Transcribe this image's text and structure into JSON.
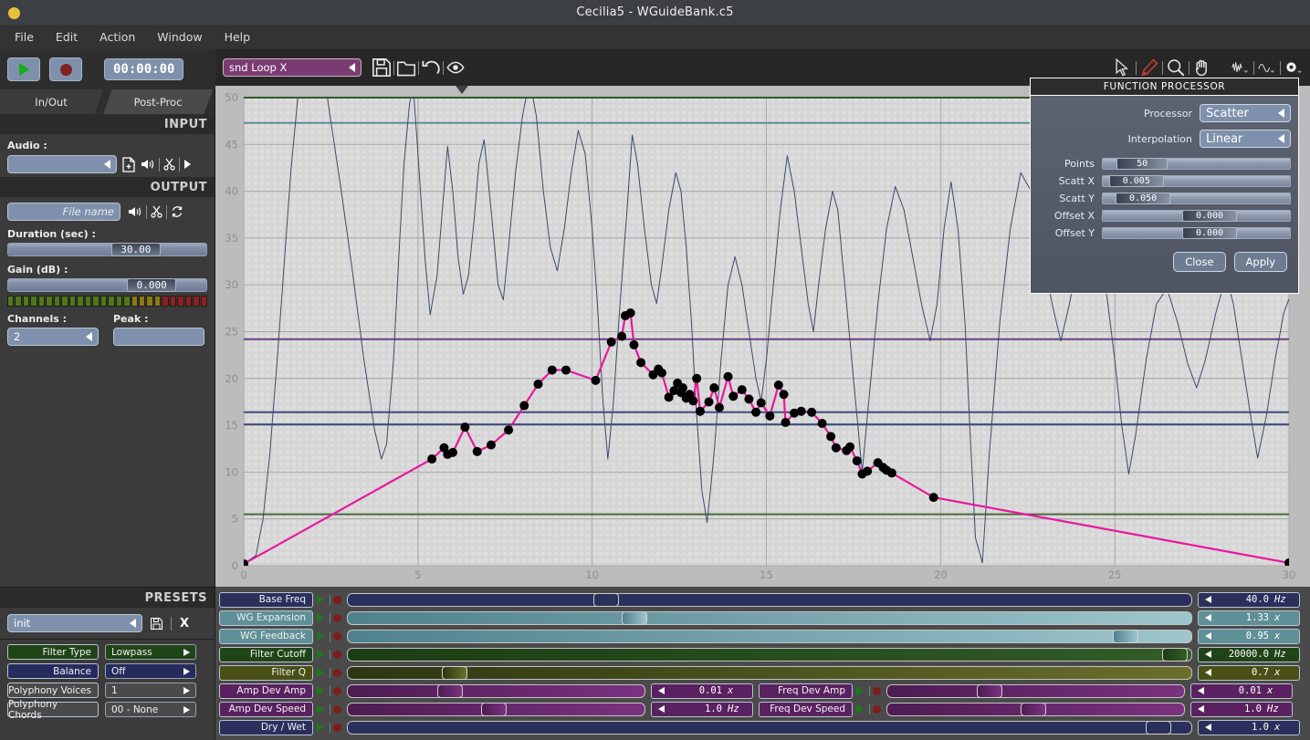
{
  "window": {
    "title": "Cecilia5 - WGuideBank.c5",
    "close_icon": "close-dot"
  },
  "menu": {
    "items": [
      "File",
      "Edit",
      "Action",
      "Window",
      "Help"
    ]
  },
  "transport": {
    "play_icon": "play-icon",
    "record_icon": "record-icon",
    "clock": "00:00:00"
  },
  "tabs": [
    {
      "label": "In/Out",
      "active": true
    },
    {
      "label": "Post-Proc",
      "active": false
    }
  ],
  "input": {
    "header": "INPUT",
    "audio_label": "Audio :",
    "audio_value": "",
    "icons": [
      "file-add-icon",
      "speaker-icon",
      "scissors-icon",
      "play-small-icon"
    ]
  },
  "output": {
    "header": "OUTPUT",
    "filename_placeholder": "File name",
    "icons": [
      "speaker-icon",
      "scissors-icon",
      "recycle-icon"
    ],
    "duration_label": "Duration (sec) :",
    "duration_value": "30.00",
    "gain_label": "Gain (dB) :",
    "gain_value": "0.000",
    "channels_label": "Channels :",
    "channels_value": "2",
    "peak_label": "Peak :",
    "peak_value": ""
  },
  "presets": {
    "header": "PRESETS",
    "selected": "init",
    "save_icon": "save-icon",
    "delete_label": "X",
    "rows": [
      {
        "name": "Filter Type",
        "value": "Lowpass",
        "color": "#1f4417",
        "has_popup": true
      },
      {
        "name": "Balance",
        "value": "Off",
        "color": "#262b5e",
        "has_popup": true
      },
      {
        "name": "Polyphony Voices",
        "value": "1",
        "color": "#585858",
        "has_popup": true
      },
      {
        "name": "Polyphony Chords",
        "value": "00 - None",
        "color": "#585858",
        "has_popup": true
      }
    ]
  },
  "toolbar": {
    "snd_popup": "snd Loop X",
    "left_icons": [
      "save-icon",
      "folder-icon",
      "undo-icon",
      "eye-icon"
    ],
    "right_icons": [
      "pointer-icon",
      "pencil-icon",
      "zoom-icon",
      "hand-icon",
      "waveform-icon",
      "envelope-icon",
      "gear-icon"
    ]
  },
  "graph": {
    "marker_icon": "playhead-marker-icon"
  },
  "chart_data": {
    "type": "line",
    "title": "",
    "xlabel": "",
    "ylabel": "",
    "xlim": [
      0,
      30
    ],
    "ylim": [
      0,
      50
    ],
    "xticks": [
      0,
      5,
      10,
      15,
      20,
      25,
      30
    ],
    "yticks": [
      0,
      5,
      10,
      15,
      20,
      25,
      30,
      35,
      40,
      45,
      50
    ],
    "grid": true,
    "legend": null,
    "hlines": [
      {
        "y": 50.0,
        "color": "#2f5a2f"
      },
      {
        "y": 47.3,
        "color": "#5f8f9b"
      },
      {
        "y": 24.2,
        "color": "#6a3f80"
      },
      {
        "y": 16.4,
        "color": "#3c4c7c"
      },
      {
        "y": 15.1,
        "color": "#3c4c7c"
      },
      {
        "y": 5.5,
        "color": "#4a6b3b"
      }
    ],
    "series": [
      {
        "name": "oscillation",
        "color": "#3b4a6b",
        "width": 1,
        "markers": false,
        "points": [
          [
            0.0,
            0.2
          ],
          [
            0.35,
            1.1
          ],
          [
            0.55,
            4.9
          ],
          [
            0.75,
            12.0
          ],
          [
            1.0,
            24.0
          ],
          [
            1.35,
            42.0
          ],
          [
            1.55,
            50.0
          ],
          [
            2.0,
            58.0
          ],
          [
            2.4,
            50.0
          ],
          [
            2.8,
            40.0
          ],
          [
            3.1,
            32.0
          ],
          [
            3.45,
            22.0
          ],
          [
            3.75,
            14.6
          ],
          [
            3.95,
            11.4
          ],
          [
            4.1,
            13.0
          ],
          [
            4.3,
            22.0
          ],
          [
            4.45,
            33.0
          ],
          [
            4.6,
            43.0
          ],
          [
            4.75,
            49.0
          ],
          [
            4.85,
            52.0
          ],
          [
            5.0,
            44.0
          ],
          [
            5.2,
            33.0
          ],
          [
            5.35,
            26.8
          ],
          [
            5.55,
            31.0
          ],
          [
            5.7,
            38.0
          ],
          [
            5.85,
            44.8
          ],
          [
            6.0,
            40.0
          ],
          [
            6.15,
            33.0
          ],
          [
            6.3,
            29.0
          ],
          [
            6.45,
            31.0
          ],
          [
            6.6,
            36.5
          ],
          [
            6.75,
            43.0
          ],
          [
            6.9,
            45.5
          ],
          [
            7.1,
            38.0
          ],
          [
            7.3,
            30.0
          ],
          [
            7.45,
            28.4
          ],
          [
            7.6,
            34.0
          ],
          [
            7.8,
            42.0
          ],
          [
            8.0,
            48.0
          ],
          [
            8.2,
            52.0
          ],
          [
            8.4,
            48.0
          ],
          [
            8.6,
            40.0
          ],
          [
            8.8,
            34.0
          ],
          [
            9.0,
            31.5
          ],
          [
            9.2,
            36.0
          ],
          [
            9.4,
            42.0
          ],
          [
            9.6,
            46.5
          ],
          [
            9.8,
            44.0
          ],
          [
            10.0,
            36.0
          ],
          [
            10.15,
            28.0
          ],
          [
            10.3,
            18.0
          ],
          [
            10.45,
            11.4
          ],
          [
            10.6,
            17.0
          ],
          [
            10.8,
            28.0
          ],
          [
            11.0,
            38.0
          ],
          [
            11.15,
            46.0
          ],
          [
            11.3,
            43.0
          ],
          [
            11.5,
            36.0
          ],
          [
            11.7,
            30.0
          ],
          [
            11.85,
            28.0
          ],
          [
            12.0,
            32.0
          ],
          [
            12.2,
            38.0
          ],
          [
            12.4,
            42.0
          ],
          [
            12.55,
            40.0
          ],
          [
            12.7,
            34.0
          ],
          [
            12.85,
            26.0
          ],
          [
            13.0,
            16.0
          ],
          [
            13.15,
            8.0
          ],
          [
            13.3,
            4.6
          ],
          [
            13.5,
            12.0
          ],
          [
            13.7,
            22.0
          ],
          [
            13.9,
            30.0
          ],
          [
            14.1,
            33.0
          ],
          [
            14.3,
            30.0
          ],
          [
            14.5,
            25.0
          ],
          [
            14.7,
            20.0
          ],
          [
            14.85,
            17.6
          ],
          [
            15.0,
            22.0
          ],
          [
            15.2,
            30.0
          ],
          [
            15.4,
            38.0
          ],
          [
            15.6,
            43.8
          ],
          [
            15.8,
            40.0
          ],
          [
            16.0,
            34.0
          ],
          [
            16.2,
            28.0
          ],
          [
            16.35,
            25.0
          ],
          [
            16.5,
            30.0
          ],
          [
            16.7,
            36.0
          ],
          [
            16.9,
            40.0
          ],
          [
            17.05,
            38.0
          ],
          [
            17.2,
            32.0
          ],
          [
            17.4,
            24.0
          ],
          [
            17.6,
            16.0
          ],
          [
            17.75,
            10.0
          ],
          [
            17.95,
            18.0
          ],
          [
            18.2,
            28.0
          ],
          [
            18.45,
            36.0
          ],
          [
            18.7,
            40.5
          ],
          [
            18.95,
            38.0
          ],
          [
            19.2,
            33.0
          ],
          [
            19.45,
            28.0
          ],
          [
            19.7,
            24.0
          ],
          [
            19.9,
            28.0
          ],
          [
            20.1,
            36.0
          ],
          [
            20.3,
            41.0
          ],
          [
            20.5,
            36.0
          ],
          [
            20.7,
            26.0
          ],
          [
            20.85,
            14.0
          ],
          [
            21.0,
            3.0
          ],
          [
            21.2,
            0.3
          ],
          [
            21.4,
            12.0
          ],
          [
            21.7,
            26.0
          ],
          [
            22.0,
            36.0
          ],
          [
            22.3,
            42.0
          ],
          [
            22.6,
            40.0
          ],
          [
            22.9,
            34.0
          ],
          [
            23.2,
            28.0
          ],
          [
            23.45,
            24.0
          ],
          [
            23.7,
            28.0
          ],
          [
            24.0,
            34.0
          ],
          [
            24.3,
            39.0
          ],
          [
            24.55,
            35.0
          ],
          [
            24.8,
            28.0
          ],
          [
            25.0,
            22.0
          ],
          [
            25.2,
            15.0
          ],
          [
            25.4,
            9.8
          ],
          [
            25.6,
            14.0
          ],
          [
            25.9,
            22.0
          ],
          [
            26.2,
            28.0
          ],
          [
            26.5,
            29.6
          ],
          [
            26.8,
            26.0
          ],
          [
            27.1,
            21.5
          ],
          [
            27.35,
            19.0
          ],
          [
            27.6,
            22.0
          ],
          [
            27.9,
            27.0
          ],
          [
            28.2,
            31.0
          ],
          [
            28.4,
            28.0
          ],
          [
            28.65,
            22.0
          ],
          [
            28.9,
            16.0
          ],
          [
            29.1,
            11.5
          ],
          [
            29.35,
            16.0
          ],
          [
            29.6,
            22.0
          ],
          [
            29.85,
            27.0
          ],
          [
            30.0,
            28.5
          ]
        ]
      },
      {
        "name": "scattered-envelope",
        "color": "#e8179e",
        "width": 2.2,
        "markers": true,
        "marker_color": "#000000",
        "marker_size": 5,
        "points": [
          [
            0.0,
            0.2
          ],
          [
            5.4,
            11.4
          ],
          [
            5.75,
            12.6
          ],
          [
            5.85,
            11.9
          ],
          [
            6.0,
            12.1
          ],
          [
            6.35,
            14.8
          ],
          [
            6.7,
            12.2
          ],
          [
            7.1,
            12.9
          ],
          [
            7.6,
            14.5
          ],
          [
            8.05,
            17.1
          ],
          [
            8.45,
            19.4
          ],
          [
            8.85,
            20.9
          ],
          [
            9.25,
            20.9
          ],
          [
            10.1,
            19.8
          ],
          [
            10.55,
            23.9
          ],
          [
            10.85,
            24.5
          ],
          [
            10.95,
            26.7
          ],
          [
            11.1,
            27.0
          ],
          [
            11.2,
            23.6
          ],
          [
            11.4,
            21.7
          ],
          [
            11.75,
            20.4
          ],
          [
            11.9,
            21.0
          ],
          [
            12.0,
            20.6
          ],
          [
            12.2,
            18.0
          ],
          [
            12.35,
            18.7
          ],
          [
            12.45,
            19.5
          ],
          [
            12.55,
            18.5
          ],
          [
            12.6,
            19.0
          ],
          [
            12.7,
            17.9
          ],
          [
            12.8,
            18.3
          ],
          [
            12.9,
            17.6
          ],
          [
            13.0,
            20.0
          ],
          [
            13.1,
            16.5
          ],
          [
            13.35,
            17.5
          ],
          [
            13.5,
            19.0
          ],
          [
            13.65,
            16.9
          ],
          [
            13.9,
            20.2
          ],
          [
            14.05,
            18.1
          ],
          [
            14.3,
            18.8
          ],
          [
            14.5,
            17.8
          ],
          [
            14.7,
            16.4
          ],
          [
            14.85,
            17.4
          ],
          [
            15.1,
            16.0
          ],
          [
            15.35,
            19.3
          ],
          [
            15.5,
            18.3
          ],
          [
            15.55,
            15.3
          ],
          [
            15.8,
            16.3
          ],
          [
            16.0,
            16.5
          ],
          [
            16.3,
            16.4
          ],
          [
            16.6,
            15.2
          ],
          [
            16.85,
            13.8
          ],
          [
            17.0,
            12.6
          ],
          [
            17.3,
            12.3
          ],
          [
            17.4,
            12.7
          ],
          [
            17.6,
            11.2
          ],
          [
            17.75,
            9.8
          ],
          [
            17.9,
            10.1
          ],
          [
            18.2,
            11.0
          ],
          [
            18.35,
            10.5
          ],
          [
            18.45,
            10.2
          ],
          [
            18.6,
            9.9
          ],
          [
            19.8,
            7.3
          ],
          [
            30.0,
            0.3
          ]
        ]
      }
    ]
  },
  "function_processor": {
    "title": "FUNCTION PROCESSOR",
    "processor_label": "Processor",
    "processor_value": "Scatter",
    "interpolation_label": "Interpolation",
    "interpolation_value": "Linear",
    "sliders": [
      {
        "label": "Points",
        "value": "50",
        "pct": 0.055,
        "kw": 56
      },
      {
        "label": "Scatt X",
        "value": "0.005",
        "pct": 0.005,
        "kw": 60
      },
      {
        "label": "Scatt Y",
        "value": "0.050",
        "pct": 0.05,
        "kw": 60
      },
      {
        "label": "Offset X",
        "value": "0.000",
        "pct": 0.5,
        "kw": 60
      },
      {
        "label": "Offset Y",
        "value": "0.000",
        "pct": 0.5,
        "kw": 60
      }
    ],
    "close_label": "Close",
    "apply_label": "Apply"
  },
  "parameters": {
    "rows": [
      {
        "name": "Base Freq",
        "color": "#2a2f5c",
        "track_from": "#2a2f5c",
        "track_to": "#2a2f5c",
        "knob_pct": 0.3,
        "value": "40.0",
        "unit": "Hz"
      },
      {
        "name": "WG Expansion",
        "color": "#5f8f97",
        "track_from": "#4f818c",
        "track_to": "#9ec6cc",
        "knob_pct": 0.335,
        "value": "1.33",
        "unit": "x"
      },
      {
        "name": "WG Feedback",
        "color": "#5f8f97",
        "track_from": "#4f818c",
        "track_to": "#9ec6cc",
        "knob_pct": 0.935,
        "value": "0.95",
        "unit": "x"
      },
      {
        "name": "Filter Cutoff",
        "color": "#1f4417",
        "track_from": "#1b3d14",
        "track_to": "#335c26",
        "knob_pct": 0.995,
        "value": "20000.0",
        "unit": "Hz"
      },
      {
        "name": "Filter Q",
        "color": "#4a4f16",
        "track_from": "#2c3612",
        "track_to": "#6a6f2a",
        "knob_pct": 0.115,
        "value": "0.7",
        "unit": "x"
      }
    ],
    "split_rows": [
      {
        "left": {
          "name": "Amp Dev Amp",
          "color": "#5a2160",
          "track_from": "#4d1b52",
          "track_to": "#7b3280",
          "knob_pct": 0.33,
          "value": "0.01",
          "unit": "x"
        },
        "right": {
          "name": "Freq Dev Amp",
          "color": "#5a2160",
          "track_from": "#4d1b52",
          "track_to": "#7b3280",
          "knob_pct": 0.33,
          "value": "0.01",
          "unit": "x"
        }
      },
      {
        "left": {
          "name": "Amp Dev Speed",
          "color": "#5a2160",
          "track_from": "#4d1b52",
          "track_to": "#7b3280",
          "knob_pct": 0.49,
          "value": "1.0",
          "unit": "Hz"
        },
        "right": {
          "name": "Freq Dev Speed",
          "color": "#5a2160",
          "track_from": "#4d1b52",
          "track_to": "#7b3280",
          "knob_pct": 0.49,
          "value": "1.0",
          "unit": "Hz"
        }
      }
    ],
    "last_row": {
      "name": "Dry / Wet",
      "color": "#2a2f5c",
      "track_from": "#2a2f5c",
      "track_to": "#2a2f5c",
      "knob_pct": 0.975,
      "value": "1.0",
      "unit": "x"
    }
  }
}
